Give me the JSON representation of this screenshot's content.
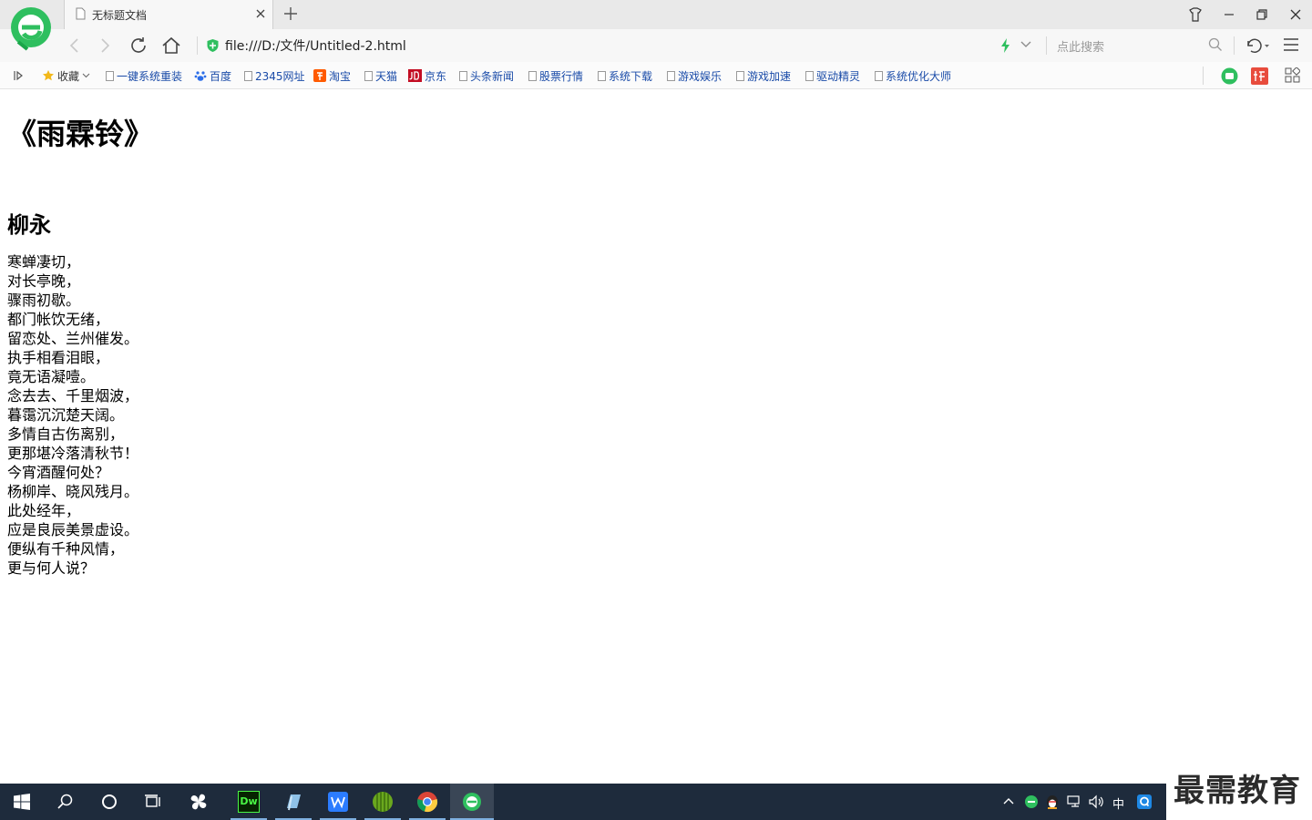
{
  "browser": {
    "tab_title": "无标题文档",
    "address": "file:///D:/文件/Untitled-2.html",
    "search_placeholder": "点此搜索"
  },
  "bookmarks": {
    "favorites_label": "收藏",
    "items": [
      "一键系统重装",
      "百度",
      "2345网址",
      "淘宝",
      "天猫",
      "京东",
      "头条新闻",
      "股票行情",
      "系统下载",
      "游戏娱乐",
      "游戏加速",
      "驱动精灵",
      "系统优化大师"
    ]
  },
  "page": {
    "heading": "《雨霖铃》",
    "author": "柳永",
    "lines": [
      "寒蝉凄切，",
      "对长亭晚，",
      "骤雨初歇。",
      "都门帐饮无绪，",
      "留恋处、兰州催发。",
      "执手相看泪眼，",
      "竟无语凝噎。",
      "念去去、千里烟波，",
      "暮霭沉沉楚天阔。",
      "多情自古伤离别，",
      "更那堪冷落清秋节！",
      "今宵酒醒何处？",
      "杨柳岸、晓风残月。",
      "此处经年，",
      "应是良辰美景虚设。",
      "便纵有千种风情，",
      "更与何人说？"
    ]
  },
  "taskbar": {
    "dw_label": "Dw",
    "ime_label": "中"
  },
  "watermark": "最需教育",
  "colors": {
    "accent_green": "#2fbf5f",
    "link_blue": "#1a4ba8",
    "taskbar_bg": "#1e2b3c"
  }
}
